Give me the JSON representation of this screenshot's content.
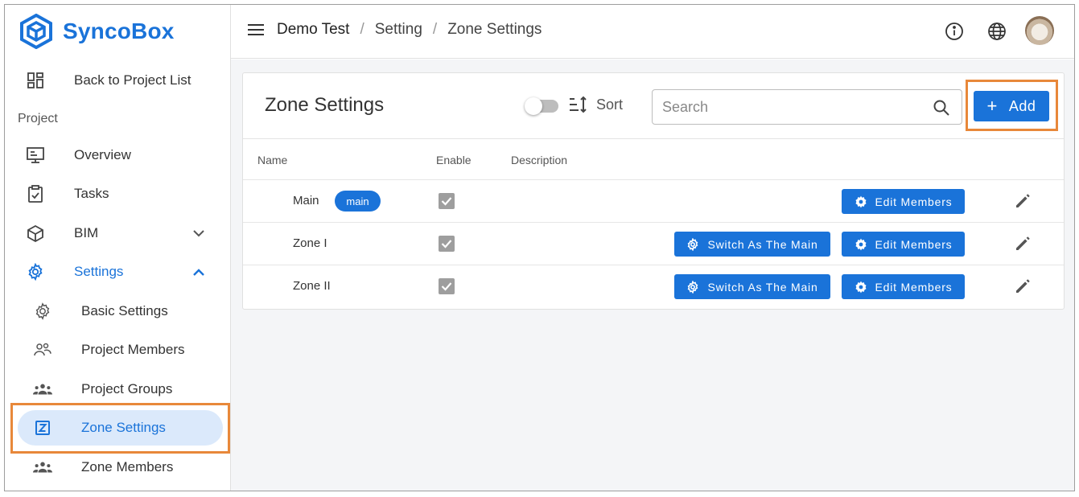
{
  "app": {
    "name": "SyncoBox"
  },
  "sidebar": {
    "back_label": "Back to Project List",
    "section_label": "Project",
    "items": [
      {
        "label": "Overview",
        "icon": "monitor-icon"
      },
      {
        "label": "Tasks",
        "icon": "clipboard-check-icon"
      },
      {
        "label": "BIM",
        "icon": "cube-icon"
      },
      {
        "label": "Settings",
        "icon": "gear-icon",
        "expanded": true
      },
      {
        "label": "Basic Settings",
        "icon": "gear-outline-icon"
      },
      {
        "label": "Project Members",
        "icon": "people-icon"
      },
      {
        "label": "Project Groups",
        "icon": "groups-icon"
      },
      {
        "label": "Zone Settings",
        "icon": "zone-icon",
        "active": true
      },
      {
        "label": "Zone Members",
        "icon": "groups-icon"
      }
    ]
  },
  "header": {
    "breadcrumb": [
      "Demo Test",
      "Setting",
      "Zone Settings"
    ],
    "separator": "/"
  },
  "panel": {
    "title": "Zone Settings",
    "sort_label": "Sort",
    "search_placeholder": "Search",
    "add_label": "Add",
    "add_icon": "+",
    "columns": [
      "Name",
      "Enable",
      "Description"
    ],
    "rows": [
      {
        "name": "Main",
        "badge": "main",
        "enabled": true,
        "description": "",
        "edit_label": "Edit Members"
      },
      {
        "name": "Zone I",
        "enabled": true,
        "description": "",
        "switch_label": "Switch As The Main",
        "edit_label": "Edit Members"
      },
      {
        "name": "Zone II",
        "enabled": true,
        "description": "",
        "switch_label": "Switch As The Main",
        "edit_label": "Edit Members"
      }
    ]
  },
  "colors": {
    "primary": "#1a73d9",
    "active_bg": "#dbe9fb",
    "highlight": "#e8883a"
  }
}
